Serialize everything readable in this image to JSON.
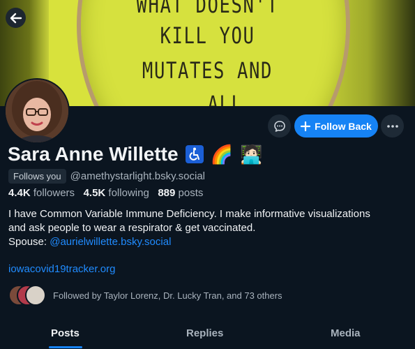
{
  "banner": {
    "lines": [
      "WHAT DOESN'T",
      "KILL YOU",
      "MUTATES AND",
      "...ALL"
    ]
  },
  "profile": {
    "display_name": "Sara Anne Willette",
    "name_emojis": [
      "♿",
      "🌈",
      "🧑🏻‍💻"
    ],
    "follows_you": "Follows you",
    "handle": "@amethystarlight.bsky.social",
    "stats": {
      "followers_count": "4.4K",
      "followers_label": "followers",
      "following_count": "4.5K",
      "following_label": "following",
      "posts_count": "889",
      "posts_label": "posts"
    },
    "bio_line1": "I have Common Variable Immune Deficiency. I make informative visualizations",
    "bio_line2": "and ask people to wear a respirator & get vaccinated.",
    "spouse_label": "Spouse: ",
    "spouse_link": "@aurielwillette.bsky.social",
    "website": "iowacovid19tracker.org",
    "followed_by": "Followed by Taylor Lorenz, Dr. Lucky Tran, and 73 others"
  },
  "actions": {
    "follow_back": "Follow Back"
  },
  "tabs": [
    {
      "label": "Posts"
    },
    {
      "label": "Replies"
    },
    {
      "label": "Media"
    }
  ],
  "icons": {
    "back": "arrow-left-icon",
    "message": "chat-bubble-icon",
    "plus": "plus-icon",
    "more": "more-horizontal-icon"
  },
  "colors": {
    "background": "#0b1520",
    "accent": "#1683f5",
    "link": "#208bfe",
    "banner": "#d8e23c"
  }
}
